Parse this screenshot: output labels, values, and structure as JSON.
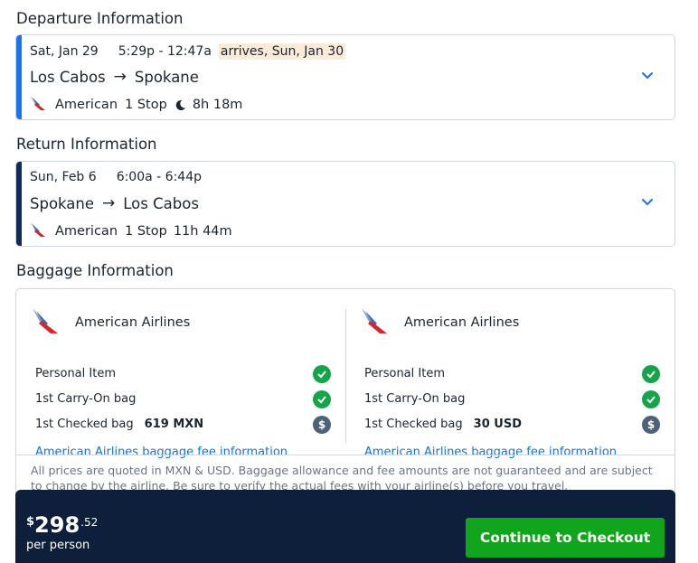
{
  "colors": {
    "accent": "#1a73e8",
    "return_accent": "#0f2b57",
    "check_green": "#16a34a",
    "cta_green": "#11a51d",
    "footer_bg": "#0e1f3b"
  },
  "departure": {
    "section_title": "Departure Information",
    "date": "Sat, Jan 29",
    "times": "5:29p - 12:47a",
    "arrives_note": "arrives, Sun, Jan 30",
    "origin": "Los Cabos",
    "arrow": "→",
    "destination": "Spokane",
    "airline": "American",
    "stops": "1 Stop",
    "overnight_icon": "moon-icon",
    "duration": "8h 18m"
  },
  "return": {
    "section_title": "Return Information",
    "date": "Sun, Feb 6",
    "times": "6:00a - 6:44p",
    "origin": "Spokane",
    "arrow": "→",
    "destination": "Los Cabos",
    "airline": "American",
    "stops": "1 Stop",
    "duration": "11h 44m"
  },
  "baggage": {
    "section_title": "Baggage Information",
    "columns": [
      {
        "airline": "American Airlines",
        "items": [
          {
            "label": "Personal Item",
            "fee": "",
            "status": "included"
          },
          {
            "label": "1st Carry-On bag",
            "fee": "",
            "status": "included"
          },
          {
            "label": "1st Checked bag",
            "fee": "619 MXN",
            "status": "fee"
          }
        ],
        "link": "American Airlines baggage fee information"
      },
      {
        "airline": "American Airlines",
        "items": [
          {
            "label": "Personal Item",
            "fee": "",
            "status": "included"
          },
          {
            "label": "1st Carry-On bag",
            "fee": "",
            "status": "included"
          },
          {
            "label": "1st Checked bag",
            "fee": "30 USD",
            "status": "fee"
          }
        ],
        "link": "American Airlines baggage fee information"
      }
    ],
    "fee_symbol": "$",
    "disclaimer": "All prices are quoted in MXN & USD. Baggage allowance and fee amounts are not guaranteed and are subject to change by the airline. Be sure to verify the actual fees with your airline(s) before you travel."
  },
  "checkout": {
    "currency_symbol": "$",
    "price_whole": "298",
    "price_cents": ".52",
    "per_person": "per person",
    "button_label": "Continue to Checkout"
  }
}
